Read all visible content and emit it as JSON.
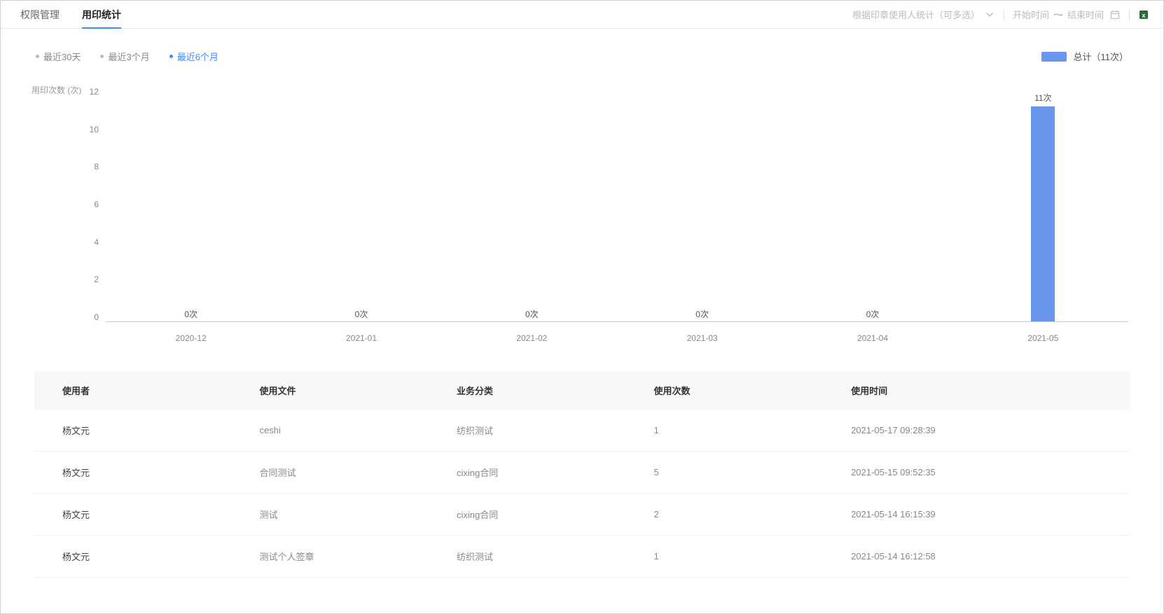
{
  "tabs": {
    "perm": "权限管理",
    "stat": "用印统计"
  },
  "filters": {
    "select_placeholder": "根据印章使用人统计（可多选）",
    "start_placeholder": "开始时间",
    "end_placeholder": "结束时间"
  },
  "ranges": {
    "last30": "最近30天",
    "last3m": "最近3个月",
    "last6m": "最近6个月"
  },
  "legend_label": "总计（11次）",
  "chart_data": {
    "type": "bar",
    "y_title": "用印次数 (次)",
    "unit": "次",
    "categories": [
      "2020-12",
      "2021-01",
      "2021-02",
      "2021-03",
      "2021-04",
      "2021-05"
    ],
    "values": [
      0,
      0,
      0,
      0,
      0,
      11
    ],
    "ylim": [
      0,
      12
    ],
    "yticks": [
      12,
      10,
      8,
      6,
      4,
      2,
      0
    ]
  },
  "table": {
    "headers": {
      "user": "使用者",
      "file": "使用文件",
      "category": "业务分类",
      "count": "使用次数",
      "time": "使用时间"
    },
    "rows": [
      {
        "user": "杨文元",
        "file": "ceshi",
        "category": "纺织测试",
        "count": "1",
        "time": "2021-05-17 09:28:39"
      },
      {
        "user": "杨文元",
        "file": "合同测试",
        "category": "cixing合同",
        "count": "5",
        "time": "2021-05-15 09:52:35"
      },
      {
        "user": "杨文元",
        "file": "测试",
        "category": "cixing合同",
        "count": "2",
        "time": "2021-05-14 16:15:39"
      },
      {
        "user": "杨文元",
        "file": "测试个人签章",
        "category": "纺织测试",
        "count": "1",
        "time": "2021-05-14 16:12:58"
      }
    ]
  }
}
